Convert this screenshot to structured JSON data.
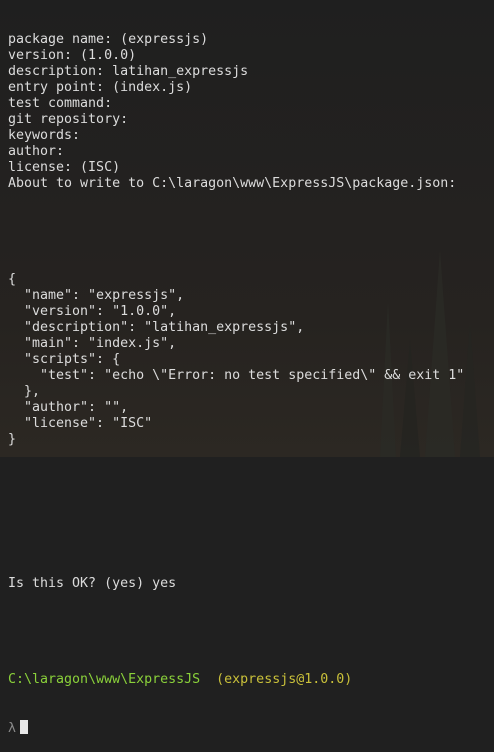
{
  "prompts": [
    "package name: (expressjs)",
    "version: (1.0.0)",
    "description: latihan_expressjs",
    "entry point: (index.js)",
    "test command:",
    "git repository:",
    "keywords:",
    "author:",
    "license: (ISC)",
    "About to write to C:\\laragon\\www\\ExpressJS\\package.json:"
  ],
  "json_preview": [
    "{",
    "  \"name\": \"expressjs\",",
    "  \"version\": \"1.0.0\",",
    "  \"description\": \"latihan_expressjs\",",
    "  \"main\": \"index.js\",",
    "  \"scripts\": {",
    "    \"test\": \"echo \\\"Error: no test specified\\\" && exit 1\"",
    "  },",
    "  \"author\": \"\",",
    "  \"license\": \"ISC\"",
    "}"
  ],
  "confirm": "Is this OK? (yes) yes",
  "status_line": {
    "path": "C:\\laragon\\www\\ExpressJS",
    "package": "(expressjs@1.0.0)"
  },
  "prompt_symbol": "λ",
  "colors": {
    "background": "#202020",
    "text": "#dcdcdc",
    "path_green": "#8ad13a",
    "package_yellow": "#c9c03a"
  }
}
